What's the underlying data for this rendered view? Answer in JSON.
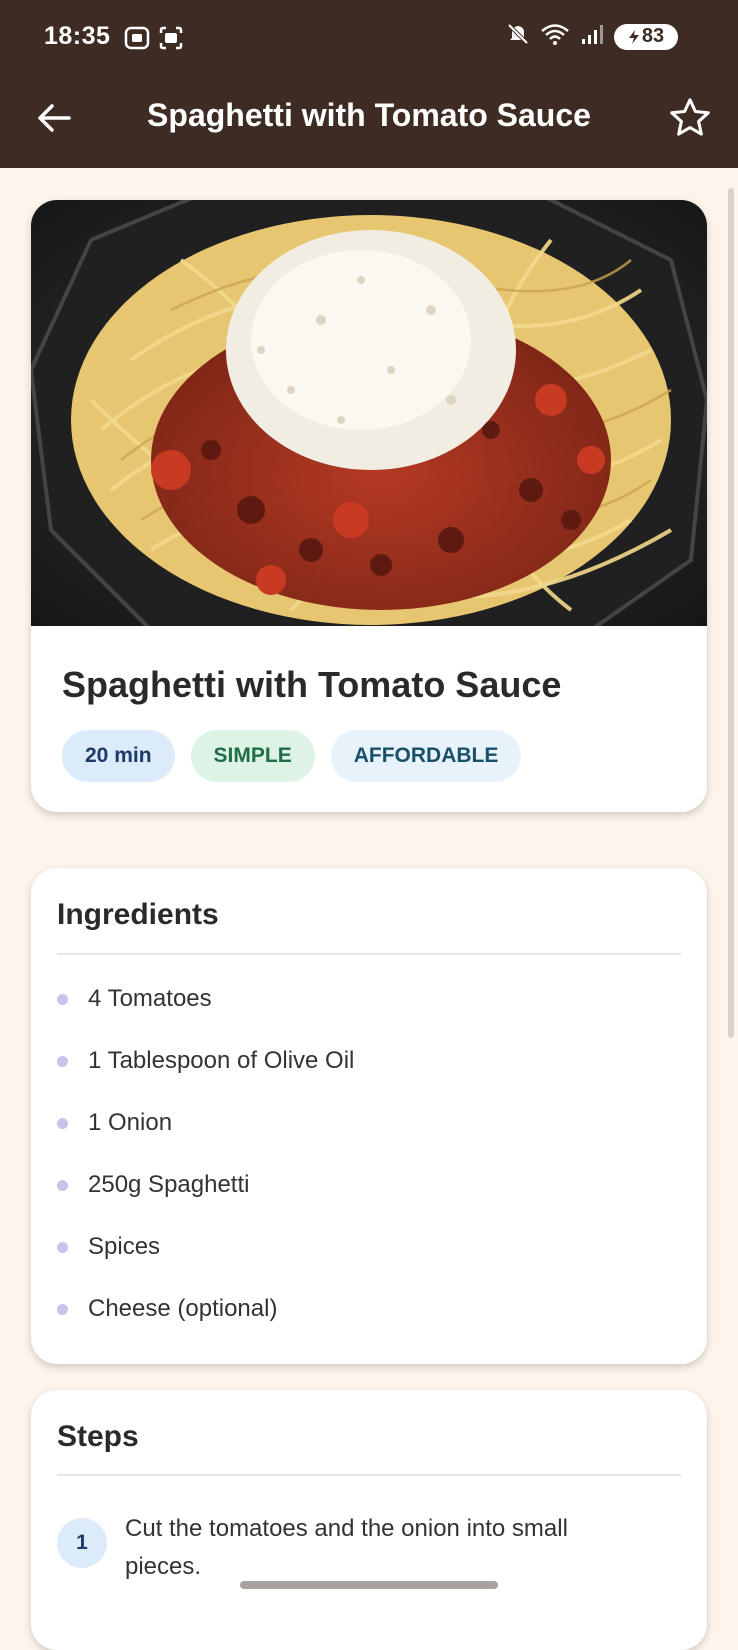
{
  "status_bar": {
    "time": "18:35",
    "battery": "83",
    "icons": [
      "screenshot-icon",
      "screen-record-icon",
      "mute-icon",
      "wifi-icon",
      "signal-icon",
      "battery-icon"
    ]
  },
  "app_bar": {
    "title": "Spaghetti with Tomato Sauce",
    "back_icon": "arrow-left-icon",
    "favorite_icon": "star-outline-icon"
  },
  "recipe": {
    "title": "Spaghetti with Tomato Sauce",
    "chips": {
      "duration": "20 min",
      "complexity": "SIMPLE",
      "affordability": "AFFORDABLE"
    }
  },
  "ingredients": {
    "title": "Ingredients",
    "items": [
      "4 Tomatoes",
      "1 Tablespoon of Olive Oil",
      "1 Onion",
      "250g Spaghetti",
      "Spices",
      "Cheese (optional)"
    ]
  },
  "steps": {
    "title": "Steps",
    "items": [
      {
        "number": "1",
        "text": "Cut the tomatoes and the onion into small pieces."
      }
    ]
  },
  "colors": {
    "app_bar": "#3E2B23",
    "background": "#FDF4EC",
    "chip_time": "#DCEBFA",
    "chip_complexity": "#DDF3E5",
    "chip_affordability": "#E8F2FB"
  }
}
